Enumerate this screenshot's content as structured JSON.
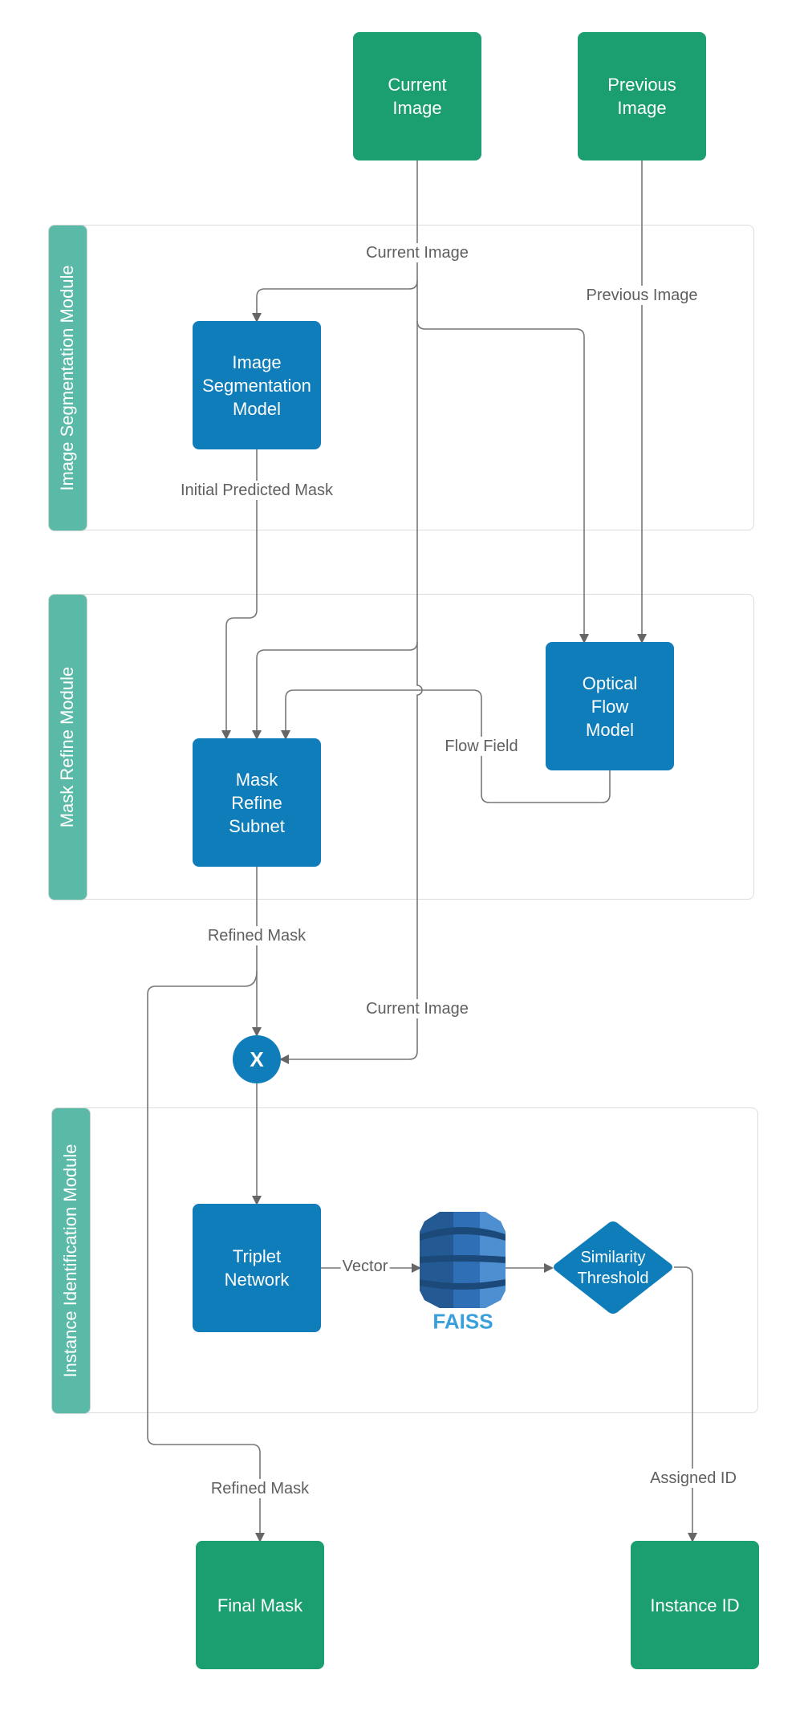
{
  "diagram": {
    "inputs": {
      "current_image": "Current Image",
      "previous_image": "Previous Image"
    },
    "lanes": [
      {
        "title": "Image Segmentation Module"
      },
      {
        "title": "Mask Refine Module"
      },
      {
        "title": "Instance Identification Module"
      }
    ],
    "nodes": {
      "image_segmentation_model": "Image Segmentation Model",
      "optical_flow_model": "Optical Flow Model",
      "mask_refine_subnet": "Mask Refine Subnet",
      "multiply": "X",
      "triplet_network": "Triplet Network",
      "faiss": "FAISS",
      "similarity_threshold": "Similarity Threshold"
    },
    "outputs": {
      "final_mask": "Final Mask",
      "instance_id": "Instance ID"
    },
    "edge_labels": {
      "current_image_1": "Current Image",
      "previous_image": "Previous Image",
      "initial_predicted_mask": "Initial Predicted Mask",
      "flow_field": "Flow Field",
      "refined_mask_1": "Refined Mask",
      "current_image_2": "Current Image",
      "vector": "Vector",
      "refined_mask_2": "Refined Mask",
      "assigned_id": "Assigned ID"
    },
    "colors": {
      "io_node": "#1b9e70",
      "process_node": "#0e7dba",
      "lane_header": "#5bbaa7",
      "faiss_label": "#3aa0dc",
      "edge": "#777777"
    }
  }
}
